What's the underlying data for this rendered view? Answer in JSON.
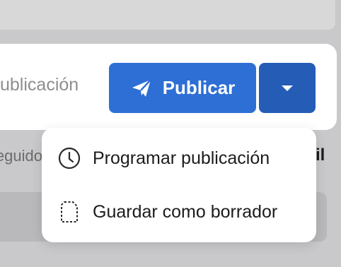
{
  "composer": {
    "placeholder_fragment": "ublicación",
    "publish_label": "Publicar",
    "publish_icon": "paper-plane-icon",
    "more_options_icon": "caret-down-icon"
  },
  "background": {
    "left_fragment": "eguido",
    "right_fragment": "il"
  },
  "menu": {
    "items": [
      {
        "label": "Programar publicación",
        "icon": "clock-icon"
      },
      {
        "label": "Guardar como borrador",
        "icon": "draft-file-icon"
      }
    ]
  },
  "colors": {
    "primary": "#2d6fd4",
    "primary_dark": "#245cb6",
    "overlay": "#c9c9cb"
  }
}
